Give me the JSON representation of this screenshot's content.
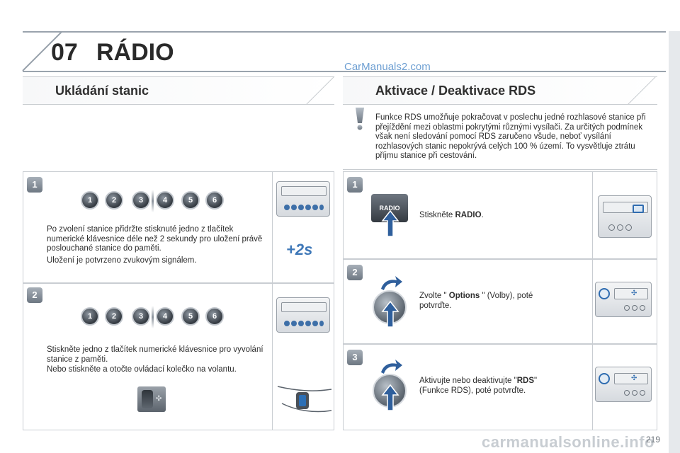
{
  "header": {
    "chapter_number": "07",
    "chapter_title": "RÁDIO",
    "watermark": "CarManuals2.com"
  },
  "left_section": {
    "title": "Ukládání stanic",
    "keys": [
      "1",
      "2",
      "3",
      "4",
      "5",
      "6"
    ],
    "step1": {
      "badge": "1",
      "text1": "Po zvolení stanice přidržte stisknuté jedno z tlačítek numerické klávesnice déle než 2 sekundy pro uložení právě poslouchané stanice do paměti.",
      "text2": "Uložení je potvrzeno zvukovým signálem.",
      "hold_label": "+2s"
    },
    "step2": {
      "badge": "2",
      "text1": "Stiskněte jedno z tlačítek numerické klávesnice pro vyvolání stanice z paměti.",
      "text2": "Nebo stiskněte a otočte ovládací kolečko na volantu."
    }
  },
  "right_section": {
    "title": "Aktivace / Deaktivace RDS",
    "info_text": "Funkce RDS umožňuje pokračovat v poslechu jedné rozhlasové stanice při přejíždění mezi oblastmi pokrytými různými vysílači. Za určitých podmínek však není sledování pomocí RDS zaručeno všude, neboť vysílání rozhlasových stanic nepokrývá celých 100 % území. To vysvětluje ztrátu příjmu stanice při cestování.",
    "step1": {
      "badge": "1",
      "button_label": "RADIO",
      "text_before": "Stiskněte ",
      "text_bold": "RADIO",
      "text_after": "."
    },
    "step2": {
      "badge": "2",
      "text_before": "Zvolte \" ",
      "text_bold": "Options",
      "text_after": " \" (Volby), poté potvrďte."
    },
    "step3": {
      "badge": "3",
      "text_before": "Aktivujte nebo deaktivujte \"",
      "text_bold": "RDS",
      "text_after": "\" (Funkce RDS), poté potvrďte."
    }
  },
  "footer": {
    "page_number": "219",
    "watermark": "carmanualsonline.info"
  }
}
